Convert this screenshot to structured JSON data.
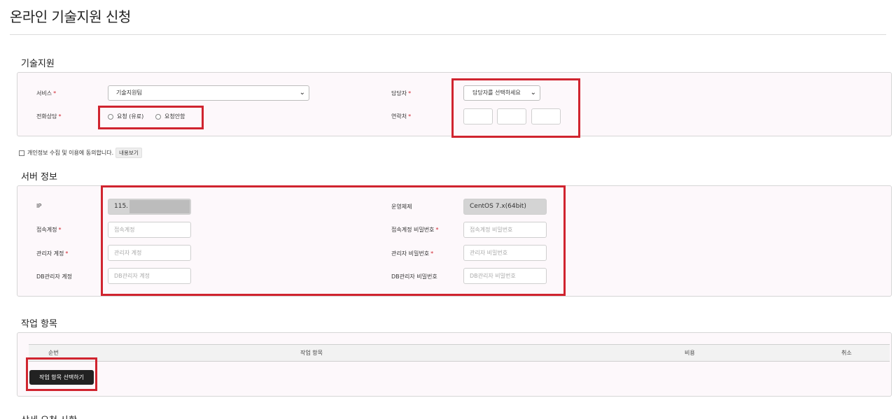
{
  "page": {
    "title": "온라인 기술지원 신청"
  },
  "tech_support": {
    "heading": "기술지원",
    "service_label": "서비스",
    "service_value": "기술지원팀",
    "manager_label": "담당자",
    "manager_value": "담당자를 선택하세요",
    "phone_consult_label": "전화상담",
    "radio_request_paid": "요청 (유료)",
    "radio_no_request": "요청안함",
    "contact_label": "연락처",
    "required_mark": "*"
  },
  "consent": {
    "text": "개인정보 수집 및 이용에 동의합니다.",
    "view_button": "내용보기"
  },
  "server_info": {
    "heading": "서버 정보",
    "ip_label": "IP",
    "ip_value": "115.",
    "os_label": "운영체제",
    "os_value": "CentOS 7.x(64bit)",
    "access_account_label": "접속계정",
    "access_account_placeholder": "접속계정",
    "access_password_label": "접속계정 비밀번호",
    "access_password_placeholder": "접속계정 비밀번호",
    "admin_account_label": "관리자 계정",
    "admin_account_placeholder": "관리자 계정",
    "admin_password_label": "관리자 비밀번호",
    "admin_password_placeholder": "관리자 비밀번호",
    "db_account_label": "DB관리자 계정",
    "db_account_placeholder": "DB관리자 계정",
    "db_password_label": "DB관리자 비밀번호",
    "db_password_placeholder": "DB관리자 비밀번호",
    "required_mark": "*"
  },
  "work_items": {
    "heading": "작업 항목",
    "columns": [
      "순번",
      "작업 항목",
      "비용",
      "취소"
    ],
    "select_button": "작업 항목 선택하기"
  },
  "next_section": {
    "heading": "상세 요청 사항"
  },
  "colors": {
    "highlight": "#d0242f",
    "panel_bg": "#fdf8fb",
    "button_dark": "#222222"
  }
}
